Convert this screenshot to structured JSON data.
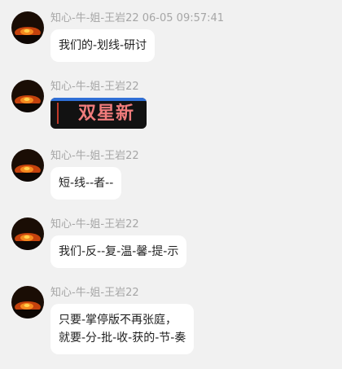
{
  "colors": {
    "background": "#f1f1f1",
    "bubble": "#ffffff",
    "meta_text": "#a6a6a6",
    "message_text": "#1f1f1f",
    "image_text": "#f07c7c"
  },
  "messages": [
    {
      "sender": "知心-牛-姐-王岩22",
      "timestamp": "06-05 09:57:41",
      "type": "text",
      "lines": [
        "我们的-划线-研讨"
      ]
    },
    {
      "sender": "知心-牛-姐-王岩22",
      "type": "image",
      "image_text": "双星新"
    },
    {
      "sender": "知心-牛-姐-王岩22",
      "type": "text",
      "lines": [
        "短-线--者--"
      ]
    },
    {
      "sender": "知心-牛-姐-王岩22",
      "type": "text",
      "lines": [
        "我们-反--复-温-馨-提-示"
      ]
    },
    {
      "sender": "知心-牛-姐-王岩22",
      "type": "text",
      "lines": [
        "只要-掌停版不再张庭，",
        "就要-分-批-收-获的-节-奏"
      ]
    }
  ]
}
